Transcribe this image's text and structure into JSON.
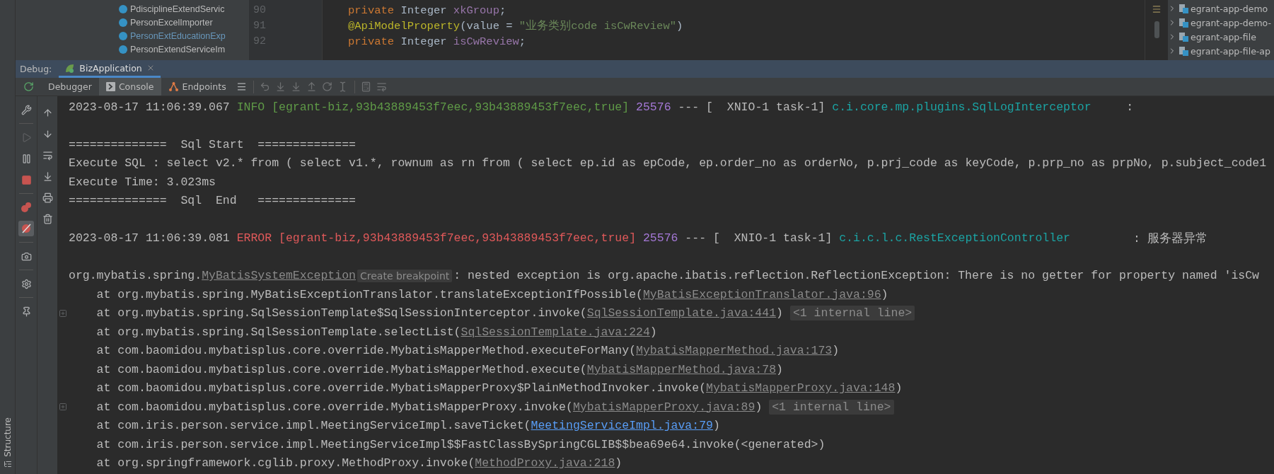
{
  "project_tree": {
    "items": [
      {
        "label": "PdisciplineExtendServic",
        "kind": "normal"
      },
      {
        "label": "PersonExcelImporter",
        "kind": "normal"
      },
      {
        "label": "PersonExtEducationExp",
        "kind": "modified"
      },
      {
        "label": "PersonExtendServiceIm",
        "kind": "normal"
      }
    ]
  },
  "editor": {
    "lines": [
      {
        "number": "90",
        "tokens": [
          {
            "kind": "keyword",
            "text": "private"
          },
          {
            "kind": "plain",
            "text": " Integer "
          },
          {
            "kind": "field",
            "text": "xkGroup"
          },
          {
            "kind": "plain",
            "text": ";"
          }
        ]
      },
      {
        "number": "91",
        "tokens": [
          {
            "kind": "annotation",
            "text": "@ApiModelProperty"
          },
          {
            "kind": "plain",
            "text": "(value = "
          },
          {
            "kind": "string",
            "text": "\"业务类别code isCwReview\""
          },
          {
            "kind": "plain",
            "text": ")"
          }
        ]
      },
      {
        "number": "92",
        "tokens": [
          {
            "kind": "keyword",
            "text": "private"
          },
          {
            "kind": "plain",
            "text": " Integer "
          },
          {
            "kind": "field",
            "text": "isCwReview"
          },
          {
            "kind": "plain",
            "text": ";"
          }
        ]
      }
    ]
  },
  "module_tree": {
    "items": [
      {
        "label": "egrant-app-demo"
      },
      {
        "label": "egrant-app-demo-"
      },
      {
        "label": "egrant-app-file"
      },
      {
        "label": "egrant-app-file-ap"
      }
    ]
  },
  "debug": {
    "label": "Debug:",
    "tabs": [
      {
        "label": "BizApplication",
        "selected": true
      }
    ]
  },
  "toolbar": {
    "tabs": [
      {
        "label": "Debugger",
        "selected": false,
        "kind": "plain"
      },
      {
        "label": "Console",
        "selected": true,
        "kind": "console"
      },
      {
        "label": "Endpoints",
        "selected": false,
        "kind": "endpoints"
      }
    ]
  },
  "side_toolbar": {
    "resume_enabled": false,
    "mute_breakpoints": true
  },
  "console": {
    "lines": [
      {
        "fold": false,
        "segments": [
          {
            "kind": "text",
            "text": "2023-08-17 11:06:39.067 "
          },
          {
            "kind": "info",
            "text": "INFO [egrant-biz,93b43889453f7eec,93b43889453f7eec,true]"
          },
          {
            "kind": "pid",
            "text": " 25576"
          },
          {
            "kind": "text",
            "text": " --- [  XNIO-1 task-1] "
          },
          {
            "kind": "logger",
            "text": "c.i.core.mp.plugins.SqlLogInterceptor"
          },
          {
            "kind": "text",
            "text": "     :"
          }
        ]
      },
      {
        "fold": false
      },
      {
        "fold": false,
        "segments": [
          {
            "kind": "text",
            "text": "==============  Sql Start  =============="
          }
        ]
      },
      {
        "fold": false,
        "segments": [
          {
            "kind": "text",
            "text": "Execute SQL : select v2.* from ( select v1.*, rownum as rn from ( select ep.id as epCode, ep.order_no as orderNo, p.prj_code as keyCode, p.prp_no as prpNo, p.subject_code1"
          }
        ]
      },
      {
        "fold": false,
        "segments": [
          {
            "kind": "text",
            "text": "Execute Time: 3.023ms"
          }
        ]
      },
      {
        "fold": false,
        "segments": [
          {
            "kind": "text",
            "text": "==============  Sql  End   =============="
          }
        ]
      },
      {
        "fold": false
      },
      {
        "fold": false,
        "segments": [
          {
            "kind": "text",
            "text": "2023-08-17 11:06:39.081 "
          },
          {
            "kind": "error",
            "text": "ERROR [egrant-biz,93b43889453f7eec,93b43889453f7eec,true]"
          },
          {
            "kind": "pid",
            "text": " 25576"
          },
          {
            "kind": "text",
            "text": " --- [  XNIO-1 task-1] "
          },
          {
            "kind": "logger",
            "text": "c.i.c.l.c.RestExceptionController"
          },
          {
            "kind": "text",
            "text": "         : 服务器异常"
          }
        ]
      },
      {
        "fold": false
      },
      {
        "fold": false,
        "segments": [
          {
            "kind": "text",
            "text": "org.mybatis.spring."
          },
          {
            "kind": "link",
            "text": "MyBatisSystemException"
          },
          {
            "kind": "hint",
            "text": "Create breakpoint"
          },
          {
            "kind": "text",
            "text": ": nested exception is org.apache.ibatis.reflection.ReflectionException: There is no getter for property named 'isCw"
          }
        ]
      },
      {
        "fold": false,
        "segments": [
          {
            "kind": "text",
            "text": "    at org.mybatis.spring.MyBatisExceptionTranslator.translateExceptionIfPossible("
          },
          {
            "kind": "link",
            "text": "MyBatisExceptionTranslator.java:96"
          },
          {
            "kind": "text",
            "text": ")"
          }
        ]
      },
      {
        "fold": true,
        "segments": [
          {
            "kind": "text",
            "text": "    at org.mybatis.spring.SqlSessionTemplate$SqlSessionInterceptor.invoke("
          },
          {
            "kind": "link",
            "text": "SqlSessionTemplate.java:441"
          },
          {
            "kind": "text",
            "text": ") "
          },
          {
            "kind": "chip",
            "text": "<1 internal line>"
          }
        ]
      },
      {
        "fold": false,
        "segments": [
          {
            "kind": "text",
            "text": "    at org.mybatis.spring.SqlSessionTemplate.selectList("
          },
          {
            "kind": "link",
            "text": "SqlSessionTemplate.java:224"
          },
          {
            "kind": "text",
            "text": ")"
          }
        ]
      },
      {
        "fold": false,
        "segments": [
          {
            "kind": "text",
            "text": "    at com.baomidou.mybatisplus.core.override.MybatisMapperMethod.executeForMany("
          },
          {
            "kind": "link",
            "text": "MybatisMapperMethod.java:173"
          },
          {
            "kind": "text",
            "text": ")"
          }
        ]
      },
      {
        "fold": false,
        "segments": [
          {
            "kind": "text",
            "text": "    at com.baomidou.mybatisplus.core.override.MybatisMapperMethod.execute("
          },
          {
            "kind": "link",
            "text": "MybatisMapperMethod.java:78"
          },
          {
            "kind": "text",
            "text": ")"
          }
        ]
      },
      {
        "fold": false,
        "segments": [
          {
            "kind": "text",
            "text": "    at com.baomidou.mybatisplus.core.override.MybatisMapperProxy$PlainMethodInvoker.invoke("
          },
          {
            "kind": "link",
            "text": "MybatisMapperProxy.java:148"
          },
          {
            "kind": "text",
            "text": ")"
          }
        ]
      },
      {
        "fold": true,
        "segments": [
          {
            "kind": "text",
            "text": "    at com.baomidou.mybatisplus.core.override.MybatisMapperProxy.invoke("
          },
          {
            "kind": "link",
            "text": "MybatisMapperProxy.java:89"
          },
          {
            "kind": "text",
            "text": ") "
          },
          {
            "kind": "chip",
            "text": "<1 internal line>"
          }
        ]
      },
      {
        "fold": false,
        "segments": [
          {
            "kind": "text",
            "text": "    at com.iris.person.service.impl.MeetingServiceImpl.saveTicket("
          },
          {
            "kind": "source",
            "text": "MeetingServiceImpl.java:79"
          },
          {
            "kind": "text",
            "text": ")"
          }
        ]
      },
      {
        "fold": false,
        "segments": [
          {
            "kind": "text",
            "text": "    at com.iris.person.service.impl.MeetingServiceImpl$$FastClassBySpringCGLIB$$bea69e64.invoke(<generated>)"
          }
        ]
      },
      {
        "fold": false,
        "segments": [
          {
            "kind": "text",
            "text": "    at org.springframework.cglib.proxy.MethodProxy.invoke("
          },
          {
            "kind": "link",
            "text": "MethodProxy.java:218"
          },
          {
            "kind": "text",
            "text": ")"
          }
        ]
      }
    ]
  },
  "structure_tab": "Structure"
}
